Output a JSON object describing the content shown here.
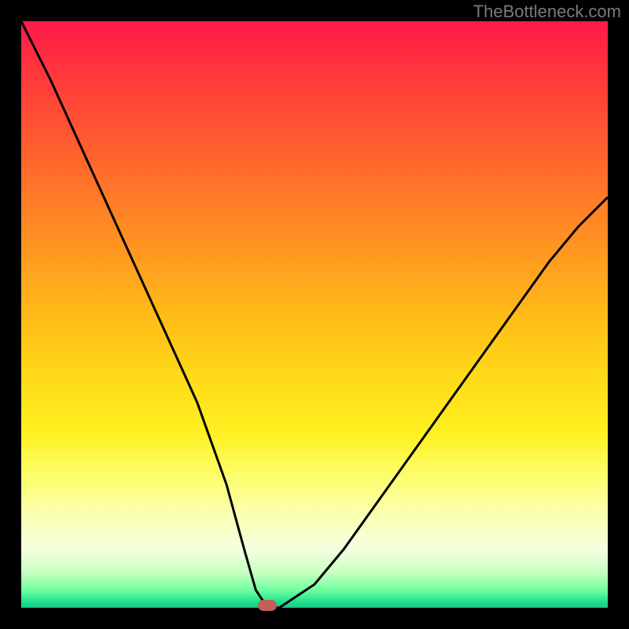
{
  "watermark": "TheBottleneck.com",
  "chart_data": {
    "type": "line",
    "title": "",
    "xlabel": "",
    "ylabel": "",
    "xlim": [
      0,
      100
    ],
    "ylim": [
      0,
      100
    ],
    "series": [
      {
        "name": "bottleneck-curve",
        "x": [
          0,
          5,
          10,
          15,
          20,
          25,
          30,
          35,
          38,
          40,
          42,
          44,
          50,
          55,
          60,
          65,
          70,
          75,
          80,
          85,
          90,
          95,
          100
        ],
        "values": [
          100,
          90,
          79,
          68,
          57,
          46,
          35,
          21,
          10,
          3,
          0,
          0,
          4,
          10,
          17,
          24,
          31,
          38,
          45,
          52,
          59,
          65,
          70
        ]
      }
    ],
    "marker": {
      "x": 42,
      "y": 0,
      "label": "optimal-point"
    },
    "gradient_stops": [
      {
        "pos": 0,
        "color": "#ff1a4a"
      },
      {
        "pos": 50,
        "color": "#ffd818"
      },
      {
        "pos": 100,
        "color": "#18c886"
      }
    ]
  }
}
